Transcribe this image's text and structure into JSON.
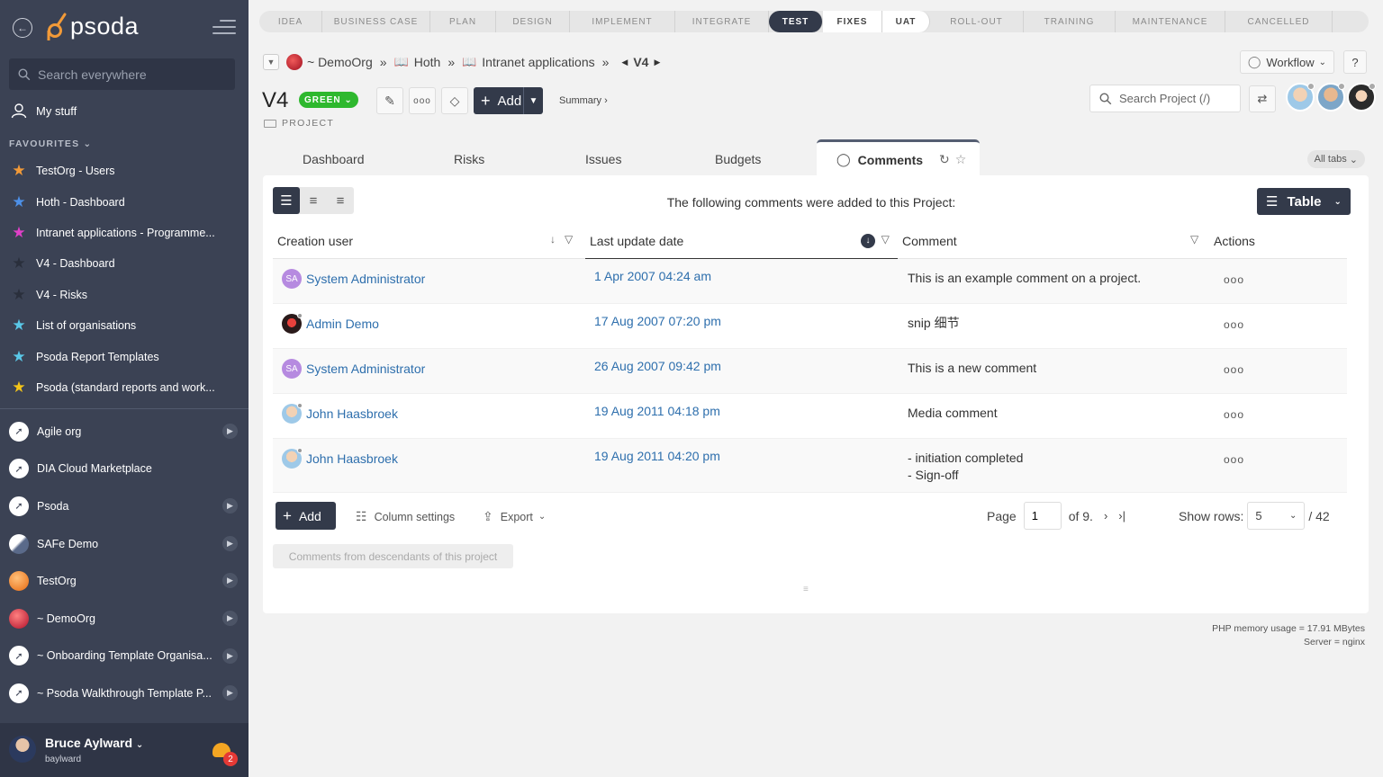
{
  "app": {
    "logo_text": "psoda"
  },
  "sidebar": {
    "search_placeholder": "Search everywhere",
    "my_stuff": "My stuff",
    "favourites_header": "FAVOURITES",
    "favourites": [
      {
        "label": "TestOrg - Users",
        "color": "#f29a38"
      },
      {
        "label": "Hoth - Dashboard",
        "color": "#4d90e8"
      },
      {
        "label": "Intranet applications - Programme...",
        "color": "#e040c8"
      },
      {
        "label": "V4 - Dashboard",
        "color": "#2a2f3c"
      },
      {
        "label": "V4 - Risks",
        "color": "#2a2f3c"
      },
      {
        "label": "List of organisations",
        "color": "#5ac8e8"
      },
      {
        "label": "Psoda Report Templates",
        "color": "#5ac8e8"
      },
      {
        "label": "Psoda (standard reports and work...",
        "color": "#f5c518"
      }
    ],
    "orgs": [
      {
        "label": "Agile org",
        "icon": "compass-icon"
      },
      {
        "label": "DIA Cloud Marketplace",
        "icon": "compass-icon"
      },
      {
        "label": "Psoda",
        "icon": "compass-icon"
      },
      {
        "label": "SAFe Demo",
        "icon": "feather-icon"
      },
      {
        "label": "TestOrg",
        "icon": "orange-planet-icon"
      },
      {
        "label": "~ DemoOrg",
        "icon": "red-planet-icon"
      },
      {
        "label": "~ Onboarding Template Organisa...",
        "icon": "compass-icon"
      },
      {
        "label": "~ Psoda Walkthrough Template P...",
        "icon": "compass-icon"
      }
    ],
    "user": {
      "name": "Bruce Aylward",
      "login": "baylward",
      "notifications": "2"
    }
  },
  "phases": [
    {
      "label": "IDEA",
      "state": "past"
    },
    {
      "label": "BUSINESS CASE",
      "state": "past"
    },
    {
      "label": "PLAN",
      "state": "past"
    },
    {
      "label": "DESIGN",
      "state": "past"
    },
    {
      "label": "IMPLEMENT",
      "state": "past"
    },
    {
      "label": "INTEGRATE",
      "state": "past"
    },
    {
      "label": "TEST",
      "state": "current"
    },
    {
      "label": "FIXES",
      "state": "next"
    },
    {
      "label": "UAT",
      "state": "next"
    },
    {
      "label": "ROLL-OUT",
      "state": "future"
    },
    {
      "label": "TRAINING",
      "state": "future"
    },
    {
      "label": "MAINTENANCE",
      "state": "future"
    },
    {
      "label": "CANCELLED",
      "state": "future"
    }
  ],
  "breadcrumb": {
    "org": "~ DemoOrg",
    "sep": "»",
    "programme": "Hoth",
    "sub": "Intranet applications",
    "current": "V4"
  },
  "header": {
    "title": "V4",
    "status": "GREEN",
    "type": "PROJECT",
    "add_label": "Add",
    "summary_label": "Summary ›",
    "workflow_label": "Workflow",
    "help_label": "?",
    "search_placeholder": "Search Project (/)"
  },
  "tabs": {
    "items": [
      "Dashboard",
      "Risks",
      "Issues",
      "Budgets"
    ],
    "active": "Comments",
    "all_tabs": "All tabs"
  },
  "comments": {
    "intro": "The following comments were added to this Project:",
    "view_label": "Table",
    "columns": [
      "Creation user",
      "Last update date",
      "Comment",
      "Actions"
    ],
    "rows": [
      {
        "user": "System Administrator",
        "avatar": "SA",
        "date": "1 Apr 2007 04:24 am",
        "comment": "This is an example comment on a project.",
        "comment2": ""
      },
      {
        "user": "Admin Demo",
        "avatar": "",
        "date": "17 Aug 2007 07:20 pm",
        "comment": "snip 细节",
        "comment2": ""
      },
      {
        "user": "System Administrator",
        "avatar": "SA",
        "date": "26 Aug 2007 09:42 pm",
        "comment": "This is a new comment",
        "comment2": ""
      },
      {
        "user": "John Haasbroek",
        "avatar": "",
        "date": "19 Aug 2011 04:18 pm",
        "comment": "Media comment",
        "comment2": ""
      },
      {
        "user": "John Haasbroek",
        "avatar": "",
        "date": "19 Aug 2011 04:20 pm",
        "comment": "- initiation completed",
        "comment2": "- Sign-off"
      }
    ],
    "footer": {
      "add_label": "Add",
      "column_settings": "Column settings",
      "export": "Export",
      "page_label": "Page",
      "page_value": "1",
      "page_of": "of 9.",
      "show_rows": "Show rows:",
      "rows_value": "5",
      "total": "/ 42",
      "descendants": "Comments from descendants of this project"
    }
  },
  "server_info": {
    "memory": "PHP memory usage = 17.91 MBytes",
    "server": "Server = nginx"
  }
}
